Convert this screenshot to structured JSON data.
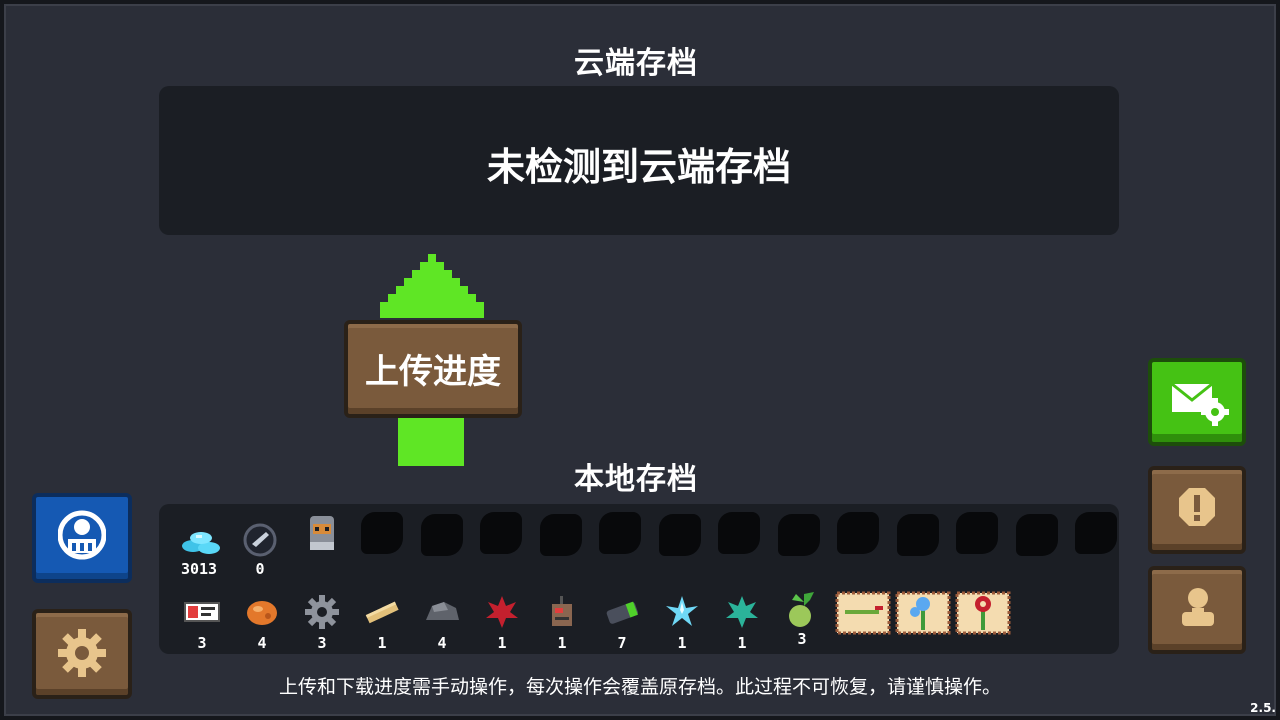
{
  "cloud": {
    "title": "云端存档",
    "message": "未检测到云端存档"
  },
  "upload": {
    "label": "上传进度"
  },
  "local": {
    "title": "本地存档",
    "currencies": [
      {
        "icon": "gem-icon",
        "count": "3013"
      },
      {
        "icon": "fish-token-icon",
        "count": "0"
      }
    ],
    "unlocked_character_icon": "knight-character-icon",
    "locked_character_count": 13,
    "materials": [
      {
        "icon": "id-card-icon",
        "count": "3"
      },
      {
        "icon": "ore-chunk-icon",
        "count": "4"
      },
      {
        "icon": "gear-part-icon",
        "count": "3"
      },
      {
        "icon": "wood-plank-icon",
        "count": "1"
      },
      {
        "icon": "stone-icon",
        "count": "4"
      },
      {
        "icon": "red-leaf-icon",
        "count": "1"
      },
      {
        "icon": "gadget-icon",
        "count": "1"
      },
      {
        "icon": "battery-icon",
        "count": "7"
      },
      {
        "icon": "ice-crystal-icon",
        "count": "1"
      },
      {
        "icon": "green-leaf-icon",
        "count": "1"
      },
      {
        "icon": "seedling-icon",
        "count": "3"
      },
      {
        "icon": "scroll-pepper-icon",
        "count": ""
      },
      {
        "icon": "scroll-blue-flower-icon",
        "count": ""
      },
      {
        "icon": "scroll-red-flower-icon",
        "count": ""
      }
    ]
  },
  "footer": {
    "notice": "上传和下载进度需手动操作，每次操作会覆盖原存档。此过程不可恢复，请谨慎操作。"
  },
  "version": "2.5.",
  "colors": {
    "background": "#2b2e38",
    "panel": "#1b1e24",
    "arrow_green": "#5fe625",
    "wood": "#7a5a3c",
    "blue_button": "#1559b3",
    "green_button": "#45c214"
  }
}
